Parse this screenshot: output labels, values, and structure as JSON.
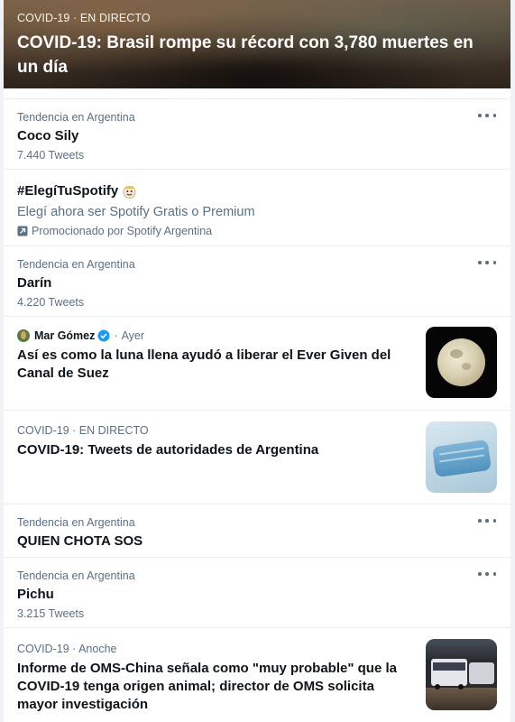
{
  "hero": {
    "meta": "COVID-19 · EN DIRECTO",
    "title": "COVID-19:  Brasil rompe su récord con 3,780 muertes en un día"
  },
  "trends": [
    {
      "meta": "Tendencia en Argentina",
      "title": "Coco Sily",
      "count": "7.440 Tweets"
    },
    {
      "meta": "Tendencia en Argentina",
      "title": "Darín",
      "count": "4.220 Tweets"
    },
    {
      "meta": "Tendencia en Argentina",
      "title": "QUIEN CHOTA SOS"
    },
    {
      "meta": "Tendencia en Argentina",
      "title": "Pichu",
      "count": "3.215 Tweets"
    }
  ],
  "promoted": {
    "title": "#ElegíTuSpotify",
    "description": "Elegí ahora ser Spotify Gratis o Premium",
    "promoted_by": "Promocionado por Spotify Argentina"
  },
  "stories": [
    {
      "author": "Mar Gómez",
      "time": "Ayer",
      "separator": "·",
      "title": "Así es como la luna llena ayudó a liberar el Ever Given del Canal de Suez",
      "thumb": "moon-image"
    },
    {
      "meta": "COVID-19 · EN DIRECTO",
      "title": "COVID-19: Tweets de autoridades de Argentina",
      "thumb": "face-mask-image"
    },
    {
      "meta": "COVID-19 · Anoche",
      "title": "Informe de OMS-China señala como \"muy probable\" que la COVID-19 tenga origen animal; director de OMS solicita mayor investigación",
      "thumb": "bus-station-image"
    }
  ],
  "colors": {
    "accent": "#1d9bf0",
    "secondary_text": "#5b7083",
    "divider": "#ebeef0"
  }
}
